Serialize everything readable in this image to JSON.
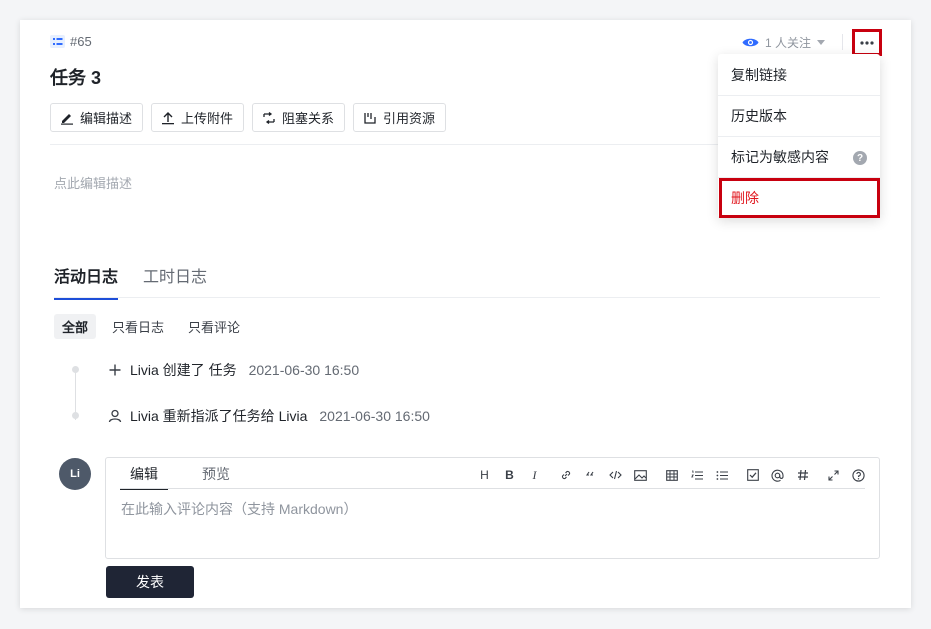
{
  "issue": {
    "id": "#65",
    "title": "任务 3"
  },
  "watch": {
    "label": "1 人关注"
  },
  "toolbar": {
    "edit_desc": "编辑描述",
    "upload": "上传附件",
    "block": "阻塞关系",
    "ref": "引用资源"
  },
  "description": {
    "placeholder": "点此编辑描述"
  },
  "tabs": {
    "activity": "活动日志",
    "worklog": "工时日志"
  },
  "filters": {
    "all": "全部",
    "logs_only": "只看日志",
    "comments_only": "只看评论"
  },
  "activities": [
    {
      "text": "Livia 创建了 任务",
      "time": "2021-06-30 16:50"
    },
    {
      "text": "Livia 重新指派了任务给  Livia",
      "time": "2021-06-30 16:50"
    }
  ],
  "avatar": {
    "initials": "Li"
  },
  "editor": {
    "tab_edit": "编辑",
    "tab_preview": "预览",
    "placeholder": "在此输入评论内容（支持 Markdown）",
    "tools": [
      "H",
      "B",
      "I"
    ]
  },
  "submit_label": "发表",
  "menu": {
    "copy_link": "复制链接",
    "history": "历史版本",
    "mark_sensitive": "标记为敏感内容",
    "help": "?",
    "delete": "删除"
  },
  "colors": {
    "accent": "#1d4ed8",
    "danger": "#e0141b",
    "highlight": "#c8000f",
    "button_dark": "#1f2535"
  }
}
